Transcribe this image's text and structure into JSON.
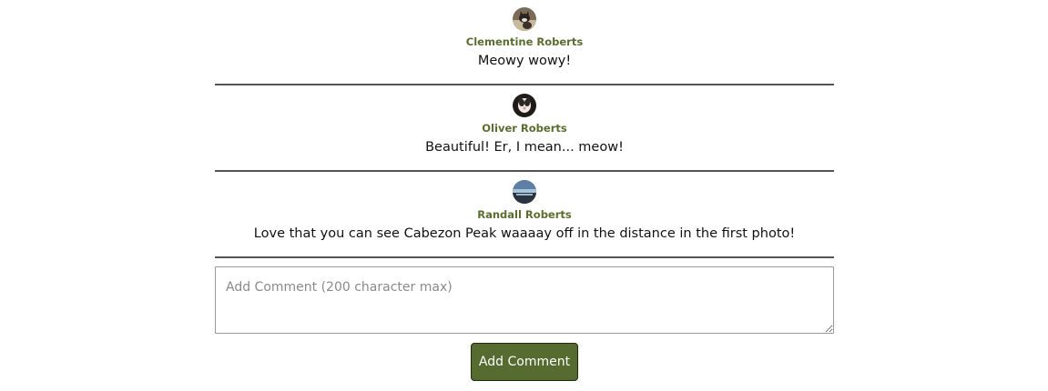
{
  "comments": [
    {
      "author": "Clementine Roberts",
      "text": "Meowy wowy!",
      "avatar_icon": "cat-photo-avatar"
    },
    {
      "author": "Oliver Roberts",
      "text": "Beautiful! Er, I mean... meow!",
      "avatar_icon": "cat-photo-avatar"
    },
    {
      "author": "Randall Roberts",
      "text": "Love that you can see Cabezon Peak waaaay off in the distance in the first photo!",
      "avatar_icon": "landscape-photo-avatar"
    }
  ],
  "form": {
    "placeholder": "Add Comment (200 character max)",
    "value": "",
    "submit_label": "Add Comment"
  },
  "colors": {
    "author": "#5a6d2f",
    "button_bg": "#556b2f",
    "divider": "#555555"
  }
}
